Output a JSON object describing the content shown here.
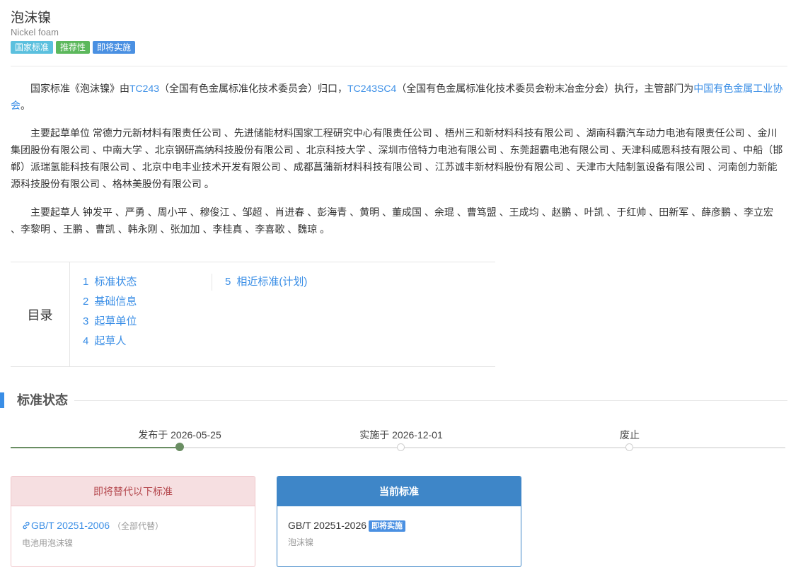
{
  "header": {
    "title": "泡沫镍",
    "subtitle": "Nickel foam",
    "badges": [
      {
        "label": "国家标准",
        "color": "#5bc0de"
      },
      {
        "label": "推荐性",
        "color": "#5cb85c"
      },
      {
        "label": "即将实施",
        "color": "#4a90e2"
      }
    ]
  },
  "intro": {
    "p1_a": "国家标准《泡沫镍》由",
    "p1_link1": "TC243",
    "p1_b": "（全国有色金属标准化技术委员会）归口，",
    "p1_link2": "TC243SC4",
    "p1_c": "（全国有色金属标准化技术委员会粉末冶金分会）执行，主管部门为",
    "p1_link3": "中国有色金属工业协会",
    "p1_d": "。",
    "p2": "主要起草单位 常德力元新材料有限责任公司 、先进储能材料国家工程研究中心有限责任公司 、梧州三和新材料科技有限公司 、湖南科霸汽车动力电池有限责任公司 、金川集团股份有限公司 、中南大学 、北京钢研高纳科技股份有限公司 、北京科技大学 、深圳市倍特力电池有限公司 、东莞超霸电池有限公司 、天津科威恩科技有限公司 、中船（邯郸）派瑞氢能科技有限公司 、北京中电丰业技术开发有限公司 、成都菖蒲新材料科技有限公司 、江苏诚丰新材料股份有限公司 、天津市大陆制氢设备有限公司 、河南创力新能源科技股份有限公司 、格林美股份有限公司 。",
    "p3": "主要起草人 钟发平 、严勇 、周小平 、穆俊江 、邹超 、肖进春 、彭海青 、黄明 、董成国 、余琨 、曹笃盟 、王成均 、赵鹏 、叶凯 、于红帅 、田新军 、薛彦鹏 、李立宏 、李黎明 、王鹏 、曹凯 、韩永刚 、张加加 、李桂真 、李喜歌 、魏琼 。"
  },
  "toc": {
    "label": "目录",
    "items": [
      {
        "num": "1",
        "label": "标准状态"
      },
      {
        "num": "2",
        "label": "基础信息"
      },
      {
        "num": "3",
        "label": "起草单位"
      },
      {
        "num": "4",
        "label": "起草人"
      },
      {
        "num": "5",
        "label": "相近标准(计划)"
      }
    ]
  },
  "status": {
    "title": "标准状态",
    "timeline": [
      {
        "label": "发布于 2026-05-25",
        "done": true
      },
      {
        "label": "实施于 2026-12-01",
        "done": false
      },
      {
        "label": "废止",
        "done": false
      }
    ]
  },
  "cards": {
    "replace": {
      "header": "即将替代以下标准",
      "code": "GB/T 20251-2006",
      "note": "（全部代替）",
      "name": "电池用泡沫镍"
    },
    "current": {
      "header": "当前标准",
      "code": "GB/T 20251-2026",
      "badge": "即将实施",
      "name": "泡沫镍"
    }
  },
  "icons": {
    "link": "link-icon"
  }
}
